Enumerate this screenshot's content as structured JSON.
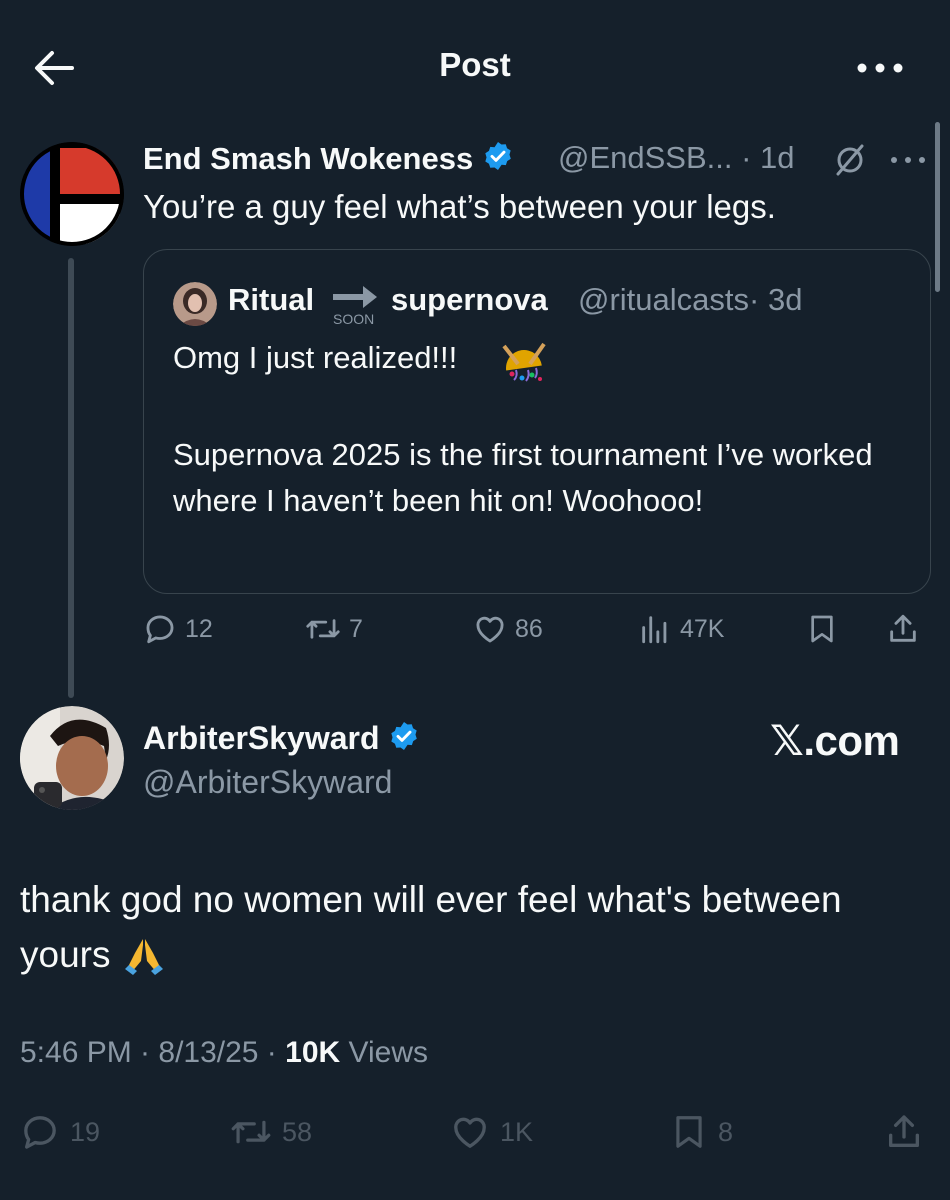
{
  "header": {
    "title": "Post",
    "back_icon": "arrow-left-icon",
    "more_icon": "more-horizontal-icon"
  },
  "parent_post": {
    "author_name": "End Smash Wokeness",
    "handle": "@EndSSB...",
    "time": "· 1d",
    "text": "You’re a guy feel what’s between your legs.",
    "avatar_colors": {
      "top_right": "#d63a2c",
      "bottom_right": "#ffffff",
      "top_left": "#1e3aa8",
      "bottom_left": "#1e3aa8",
      "bands": "#000000"
    },
    "quoted": {
      "author_name": "Ritual",
      "soon_label": "SOON",
      "author_name_2": "supernova",
      "handle": "@ritualcasts",
      "time": "· 3d",
      "line1": "Omg I just realized!!!",
      "emoji": "confetti-ball",
      "body": "Supernova 2025 is the first tournament I’ve worked where I haven’t been hit on! Woohooo!"
    },
    "stats": {
      "replies": "12",
      "reposts": "7",
      "likes": "86",
      "views": "47K"
    }
  },
  "main_post": {
    "author_name": "ArbiterSkyward",
    "handle": "@ArbiterSkyward",
    "watermark": "𝕏.com",
    "text": "thank god no women will ever feel what's between yours",
    "emoji": "folded-hands",
    "time": "5:46 PM · 8/13/25 · ",
    "views_count": "10K",
    "views_label": " Views",
    "stats": {
      "replies": "19",
      "reposts": "58",
      "likes": "1K",
      "bookmarks": "8"
    }
  },
  "colors": {
    "background": "#15202b",
    "text": "#f7f9f9",
    "secondary": "#8b98a5",
    "verified": "#1d9bf0",
    "border": "#38444d"
  }
}
